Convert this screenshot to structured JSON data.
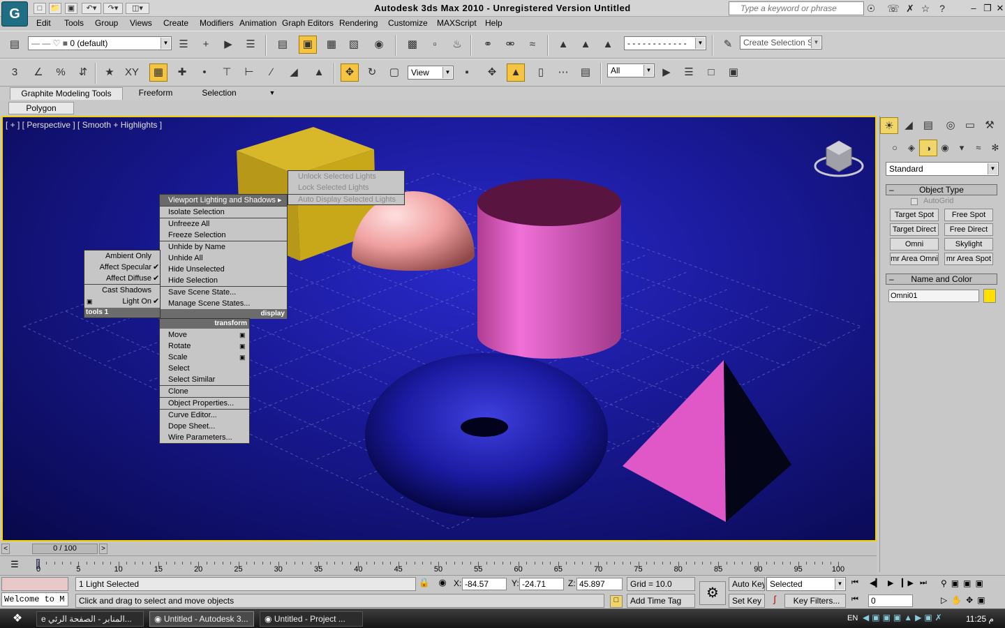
{
  "app": {
    "title": "Autodesk 3ds Max  2010   -  Unregistered Version    Untitled",
    "logo": "G",
    "search_placeholder": "Type a keyword or phrase"
  },
  "menubar": [
    "Edit",
    "Tools",
    "Group",
    "Views",
    "Create",
    "Modifiers",
    "Animation",
    "Graph Editors",
    "Rendering",
    "Customize",
    "MAXScript",
    "Help"
  ],
  "toolbar1": {
    "layer": "0 (default)",
    "selection_set": "Create Selection Se",
    "dashed_dropdown": "- - - - - - - - - - - -"
  },
  "toolbar2": {
    "ref_coord": "View",
    "filter": "All",
    "snap_labels": [
      "3",
      "%",
      "XY"
    ]
  },
  "ribbon": {
    "tabs": [
      "Graphite Modeling Tools",
      "Freeform",
      "Selection"
    ],
    "panel": "Polygon Modeling"
  },
  "viewport": {
    "label": "[ + ] [ Perspective ] [ Smooth + Highlights ]"
  },
  "quad_left": {
    "items": [
      "Ambient Only",
      "Affect Specular",
      "Affect Diffuse",
      "Cast Shadows",
      "Light On"
    ],
    "checked": [
      false,
      true,
      true,
      false,
      true
    ],
    "footer": "tools 1"
  },
  "quad_top": {
    "items": [
      "Viewport Lighting and Shadows",
      "Isolate Selection",
      "Unfreeze All",
      "Freeze Selection",
      "Unhide by Name",
      "Unhide All",
      "Hide Unselected",
      "Hide Selection",
      "Save Scene State...",
      "Manage Scene States..."
    ],
    "footer": "display"
  },
  "quad_sub": {
    "items": [
      "Unlock Selected Lights",
      "Lock Selected Lights",
      "Auto Display Selected Lights"
    ]
  },
  "quad_bottom": {
    "header": "transform",
    "items": [
      "Move",
      "Rotate",
      "Scale",
      "Select",
      "Select Similar",
      "Clone",
      "Object Properties...",
      "Curve Editor...",
      "Dope Sheet...",
      "Wire Parameters..."
    ]
  },
  "command_panel": {
    "category": "Standard",
    "object_type_title": "Object Type",
    "autogrid": "AutoGrid",
    "buttons": [
      "Target Spot",
      "Free Spot",
      "Target Direct",
      "Free Direct",
      "Omni",
      "Skylight",
      "mr Area Omni",
      "mr Area Spot"
    ],
    "name_color_title": "Name and Color",
    "name_value": "Omni01",
    "object_color": "#ffe000"
  },
  "timeline": {
    "frame": "0 / 100",
    "ticks": [
      "0",
      "5",
      "10",
      "15",
      "20",
      "25",
      "30",
      "35",
      "40",
      "45",
      "50",
      "55",
      "60",
      "65",
      "70",
      "75",
      "80",
      "85",
      "90",
      "95",
      "100"
    ]
  },
  "status": {
    "selection": "1 Light Selected",
    "prompt": "Click and drag to select and move objects",
    "maxscript": "Welcome to M",
    "x": "-84.57",
    "y": "-24.71",
    "z": "45.897",
    "x_label": "X:",
    "y_label": "Y:",
    "z_label": "Z:",
    "grid": "Grid = 10.0",
    "add_time_tag": "Add Time Tag",
    "auto_key": "Auto Key",
    "set_key": "Set Key",
    "key_mode": "Selected",
    "key_filters": "Key Filters...",
    "current_frame": "0"
  },
  "taskbar": {
    "tasks": [
      "المنابر - الصفحة الرئي...",
      "Untitled - Autodesk 3...",
      "Untitled      - Project ..."
    ],
    "lang": "EN",
    "clock": "11:25 م"
  },
  "colors": {
    "viewport_border": "#f0d000",
    "active_tool": "#f5c542",
    "cube": "#c8a818",
    "hemisphere": "#f0a0a0",
    "cylinder": "#e060c8",
    "torus": "#1a1aa0",
    "pyramid": "#e058c8"
  }
}
